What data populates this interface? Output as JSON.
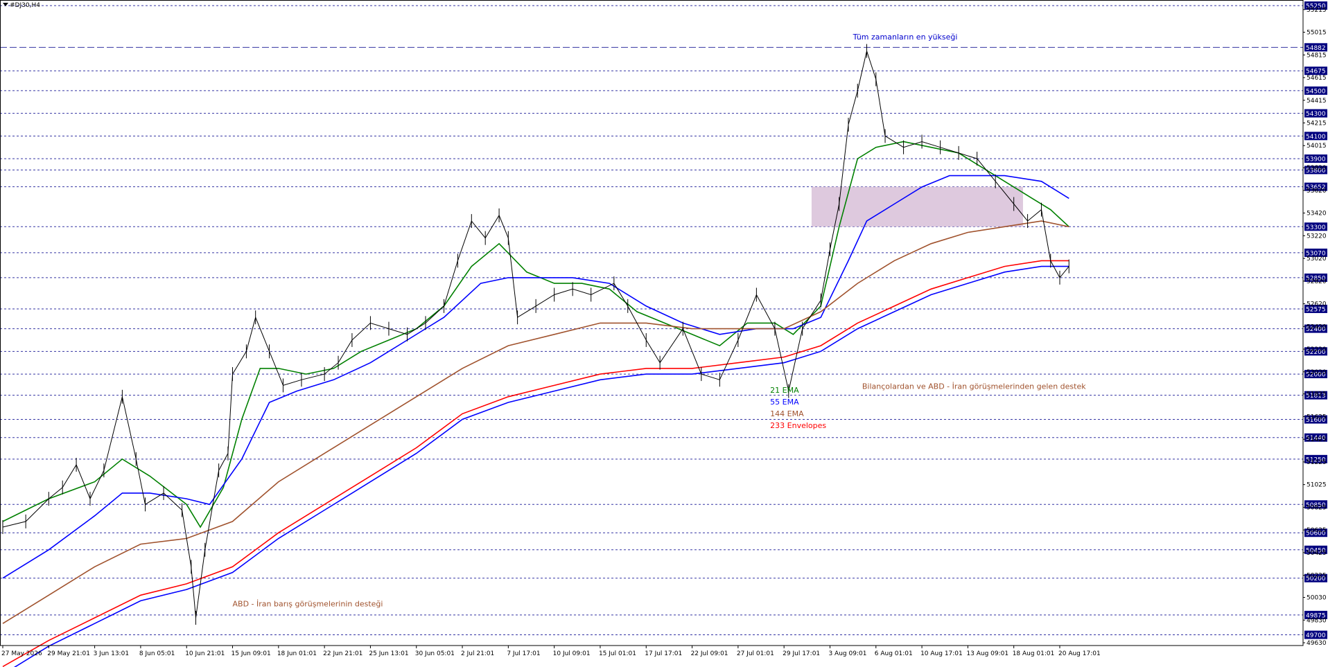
{
  "window": {
    "symbol_label": "#DJ30,H4"
  },
  "chart_data": {
    "type": "line",
    "title": "#DJ30,H4",
    "ylim": [
      49630,
      55275
    ],
    "grid": false,
    "levels": [
      {
        "value": 55250,
        "label": "55250"
      },
      {
        "value": 54882,
        "label": "54882",
        "style": "dashed-long"
      },
      {
        "value": 54675,
        "label": "54675"
      },
      {
        "value": 54500,
        "label": "54500"
      },
      {
        "value": 54300,
        "label": "54300"
      },
      {
        "value": 54100,
        "label": "54100"
      },
      {
        "value": 53900,
        "label": "53900"
      },
      {
        "value": 53800,
        "label": "53800"
      },
      {
        "value": 53652,
        "label": "53652"
      },
      {
        "value": 53300,
        "label": "53300"
      },
      {
        "value": 53070,
        "label": "53070"
      },
      {
        "value": 52850,
        "label": "52850"
      },
      {
        "value": 52575,
        "label": "52575"
      },
      {
        "value": 52400,
        "label": "52400"
      },
      {
        "value": 52200,
        "label": "52200"
      },
      {
        "value": 52000,
        "label": "52000"
      },
      {
        "value": 51813,
        "label": "51813"
      },
      {
        "value": 51600,
        "label": "51600"
      },
      {
        "value": 51440,
        "label": "51440"
      },
      {
        "value": 51250,
        "label": "51250"
      },
      {
        "value": 50850,
        "label": "50850"
      },
      {
        "value": 50600,
        "label": "50600"
      },
      {
        "value": 50450,
        "label": "50450"
      },
      {
        "value": 50200,
        "label": "50200"
      },
      {
        "value": 49875,
        "label": "49875"
      },
      {
        "value": 49700,
        "label": "49700"
      }
    ],
    "y_ticks": [
      "55215",
      "55015",
      "54815",
      "54615",
      "54415",
      "54215",
      "54015",
      "53820",
      "53620",
      "53420",
      "53220",
      "53020",
      "52820",
      "52620",
      "52420",
      "52220",
      "52020",
      "51825",
      "51625",
      "51425",
      "51225",
      "51025",
      "50825",
      "50625",
      "50425",
      "50225",
      "50030",
      "49830",
      "49630"
    ],
    "x_ticks": [
      "27 May 2026",
      "29 May 21:01",
      "3 Jun 13:01",
      "8 Jun 05:01",
      "10 Jun 21:01",
      "15 Jun 09:01",
      "18 Jun 01:01",
      "22 Jun 21:01",
      "25 Jun 13:01",
      "30 Jun 05:01",
      "2 Jul 21:01",
      "7 Jul 17:01",
      "10 Jul 09:01",
      "15 Jul 01:01",
      "17 Jul 17:01",
      "22 Jul 09:01",
      "27 Jul 01:01",
      "29 Jul 17:01",
      "3 Aug 09:01",
      "6 Aug 01:01",
      "10 Aug 17:01",
      "13 Aug 09:01",
      "18 Aug 01:01",
      "20 Aug 17:01"
    ],
    "zone": {
      "from_tick": 17.6,
      "to_tick": 22.2,
      "y_low": 53300,
      "y_high": 53652,
      "color": "#d8bfd8"
    },
    "price": [
      [
        0,
        50650
      ],
      [
        0.5,
        50700
      ],
      [
        1,
        50900
      ],
      [
        1.3,
        51000
      ],
      [
        1.6,
        51200
      ],
      [
        1.9,
        50900
      ],
      [
        2.2,
        51150
      ],
      [
        2.6,
        51800
      ],
      [
        2.9,
        51250
      ],
      [
        3.1,
        50850
      ],
      [
        3.5,
        50950
      ],
      [
        3.9,
        50800
      ],
      [
        4.1,
        50300
      ],
      [
        4.2,
        49850
      ],
      [
        4.4,
        50450
      ],
      [
        4.7,
        51150
      ],
      [
        4.9,
        51300
      ],
      [
        5.0,
        52000
      ],
      [
        5.3,
        52200
      ],
      [
        5.5,
        52500
      ],
      [
        5.8,
        52200
      ],
      [
        6.1,
        51900
      ],
      [
        6.5,
        51950
      ],
      [
        7.0,
        52000
      ],
      [
        7.3,
        52100
      ],
      [
        7.6,
        52300
      ],
      [
        8.0,
        52450
      ],
      [
        8.4,
        52400
      ],
      [
        8.8,
        52350
      ],
      [
        9.2,
        52450
      ],
      [
        9.6,
        52600
      ],
      [
        9.9,
        53000
      ],
      [
        10.2,
        53350
      ],
      [
        10.5,
        53200
      ],
      [
        10.8,
        53400
      ],
      [
        11.0,
        53200
      ],
      [
        11.2,
        52500
      ],
      [
        11.6,
        52600
      ],
      [
        12.0,
        52700
      ],
      [
        12.4,
        52750
      ],
      [
        12.8,
        52700
      ],
      [
        13.3,
        52800
      ],
      [
        13.6,
        52600
      ],
      [
        14.0,
        52300
      ],
      [
        14.3,
        52100
      ],
      [
        14.8,
        52400
      ],
      [
        15.2,
        52000
      ],
      [
        15.6,
        51950
      ],
      [
        16.0,
        52300
      ],
      [
        16.4,
        52700
      ],
      [
        16.8,
        52400
      ],
      [
        17.1,
        51850
      ],
      [
        17.4,
        52400
      ],
      [
        17.8,
        52650
      ],
      [
        18.0,
        53100
      ],
      [
        18.2,
        53500
      ],
      [
        18.4,
        54200
      ],
      [
        18.6,
        54500
      ],
      [
        18.8,
        54850
      ],
      [
        19.0,
        54600
      ],
      [
        19.2,
        54100
      ],
      [
        19.6,
        54000
      ],
      [
        20.0,
        54050
      ],
      [
        20.4,
        54000
      ],
      [
        20.8,
        53950
      ],
      [
        21.2,
        53900
      ],
      [
        21.6,
        53700
      ],
      [
        22.0,
        53500
      ],
      [
        22.3,
        53350
      ],
      [
        22.6,
        53450
      ],
      [
        22.8,
        53000
      ],
      [
        23.0,
        52850
      ],
      [
        23.2,
        52950
      ]
    ],
    "series": [
      {
        "name": "21 EMA",
        "color": "#008000",
        "points": [
          [
            0,
            50700
          ],
          [
            1,
            50900
          ],
          [
            2,
            51050
          ],
          [
            2.6,
            51250
          ],
          [
            3.2,
            51100
          ],
          [
            4.0,
            50850
          ],
          [
            4.3,
            50650
          ],
          [
            4.8,
            51000
          ],
          [
            5.2,
            51600
          ],
          [
            5.6,
            52050
          ],
          [
            6.0,
            52050
          ],
          [
            6.6,
            52000
          ],
          [
            7.2,
            52050
          ],
          [
            7.8,
            52200
          ],
          [
            8.4,
            52300
          ],
          [
            9.0,
            52400
          ],
          [
            9.6,
            52600
          ],
          [
            10.2,
            52950
          ],
          [
            10.8,
            53150
          ],
          [
            11.4,
            52900
          ],
          [
            12.0,
            52800
          ],
          [
            12.6,
            52800
          ],
          [
            13.2,
            52750
          ],
          [
            13.8,
            52550
          ],
          [
            14.4,
            52450
          ],
          [
            15.0,
            52350
          ],
          [
            15.6,
            52250
          ],
          [
            16.2,
            52450
          ],
          [
            16.8,
            52450
          ],
          [
            17.2,
            52350
          ],
          [
            17.8,
            52600
          ],
          [
            18.2,
            53300
          ],
          [
            18.6,
            53900
          ],
          [
            19.0,
            54000
          ],
          [
            19.6,
            54050
          ],
          [
            20.2,
            54000
          ],
          [
            20.8,
            53950
          ],
          [
            21.2,
            53850
          ],
          [
            21.8,
            53700
          ],
          [
            22.4,
            53550
          ],
          [
            22.8,
            53450
          ],
          [
            23.2,
            53300
          ]
        ]
      },
      {
        "name": "55 EMA",
        "color": "#0000ff",
        "points": [
          [
            0,
            50200
          ],
          [
            1,
            50450
          ],
          [
            2,
            50750
          ],
          [
            2.6,
            50950
          ],
          [
            3.2,
            50950
          ],
          [
            4.0,
            50900
          ],
          [
            4.5,
            50850
          ],
          [
            5.2,
            51250
          ],
          [
            5.8,
            51750
          ],
          [
            6.4,
            51850
          ],
          [
            7.2,
            51950
          ],
          [
            8.0,
            52100
          ],
          [
            8.8,
            52300
          ],
          [
            9.6,
            52500
          ],
          [
            10.4,
            52800
          ],
          [
            11.0,
            52850
          ],
          [
            11.6,
            52850
          ],
          [
            12.4,
            52850
          ],
          [
            13.2,
            52800
          ],
          [
            14.0,
            52600
          ],
          [
            14.8,
            52450
          ],
          [
            15.6,
            52350
          ],
          [
            16.4,
            52400
          ],
          [
            17.2,
            52400
          ],
          [
            17.8,
            52500
          ],
          [
            18.4,
            53000
          ],
          [
            18.8,
            53350
          ],
          [
            19.4,
            53500
          ],
          [
            20.0,
            53650
          ],
          [
            20.6,
            53750
          ],
          [
            21.2,
            53750
          ],
          [
            21.8,
            53750
          ],
          [
            22.6,
            53700
          ],
          [
            23.2,
            53550
          ]
        ]
      },
      {
        "name": "144 EMA",
        "color": "#a0522d",
        "points": [
          [
            0,
            49800
          ],
          [
            1,
            50050
          ],
          [
            2,
            50300
          ],
          [
            3,
            50500
          ],
          [
            4,
            50550
          ],
          [
            5,
            50700
          ],
          [
            6,
            51050
          ],
          [
            7,
            51300
          ],
          [
            8,
            51550
          ],
          [
            9,
            51800
          ],
          [
            10,
            52050
          ],
          [
            11,
            52250
          ],
          [
            12,
            52350
          ],
          [
            13,
            52450
          ],
          [
            14,
            52450
          ],
          [
            15,
            52400
          ],
          [
            16,
            52400
          ],
          [
            17,
            52400
          ],
          [
            17.8,
            52550
          ],
          [
            18.6,
            52800
          ],
          [
            19.4,
            53000
          ],
          [
            20.2,
            53150
          ],
          [
            21.0,
            53250
          ],
          [
            21.8,
            53300
          ],
          [
            22.6,
            53350
          ],
          [
            23.2,
            53300
          ]
        ]
      },
      {
        "name": "233 Envelopes",
        "color": "#ff0000",
        "points": [
          [
            0,
            49420
          ],
          [
            1,
            49650
          ],
          [
            2,
            49850
          ],
          [
            3,
            50050
          ],
          [
            4,
            50150
          ],
          [
            5,
            50300
          ],
          [
            6,
            50600
          ],
          [
            7,
            50850
          ],
          [
            8,
            51100
          ],
          [
            9,
            51350
          ],
          [
            10,
            51650
          ],
          [
            11,
            51800
          ],
          [
            12,
            51900
          ],
          [
            13,
            52000
          ],
          [
            14,
            52050
          ],
          [
            15,
            52050
          ],
          [
            16,
            52100
          ],
          [
            17,
            52150
          ],
          [
            17.8,
            52250
          ],
          [
            18.6,
            52450
          ],
          [
            19.4,
            52600
          ],
          [
            20.2,
            52750
          ],
          [
            21.0,
            52850
          ],
          [
            21.8,
            52950
          ],
          [
            22.6,
            53000
          ],
          [
            23.2,
            53000
          ]
        ]
      },
      {
        "name": "233 Envelopes lower",
        "color": "#0000ff",
        "points": [
          [
            0,
            49350
          ],
          [
            1,
            49600
          ],
          [
            2,
            49800
          ],
          [
            3,
            50000
          ],
          [
            4,
            50100
          ],
          [
            5,
            50250
          ],
          [
            6,
            50550
          ],
          [
            7,
            50800
          ],
          [
            8,
            51050
          ],
          [
            9,
            51300
          ],
          [
            10,
            51600
          ],
          [
            11,
            51750
          ],
          [
            12,
            51850
          ],
          [
            13,
            51950
          ],
          [
            14,
            52000
          ],
          [
            15,
            52000
          ],
          [
            16,
            52050
          ],
          [
            17,
            52100
          ],
          [
            17.8,
            52200
          ],
          [
            18.6,
            52400
          ],
          [
            19.4,
            52550
          ],
          [
            20.2,
            52700
          ],
          [
            21.0,
            52800
          ],
          [
            21.8,
            52900
          ],
          [
            22.6,
            52950
          ],
          [
            23.2,
            52950
          ]
        ]
      }
    ],
    "annotations": [
      {
        "text": "Tüm zamanların en yükseği",
        "x_tick": 18.5,
        "y": 54950,
        "color": "#0000cd"
      },
      {
        "text": "Bilançolardan ve ABD - İran görüşmelerinden gelen destek",
        "x_tick": 18.7,
        "y": 51870,
        "color": "#a0522d"
      },
      {
        "text": "ABD - İran barış görüşmelerinin desteği",
        "x_tick": 5.0,
        "y": 49950,
        "color": "#a0522d"
      }
    ],
    "legend": [
      {
        "text": "21 EMA",
        "color": "#008000"
      },
      {
        "text": "55 EMA",
        "color": "#0000ff"
      },
      {
        "text": "144 EMA",
        "color": "#a0522d"
      },
      {
        "text": "233 Envelopes",
        "color": "#ff0000"
      }
    ]
  }
}
